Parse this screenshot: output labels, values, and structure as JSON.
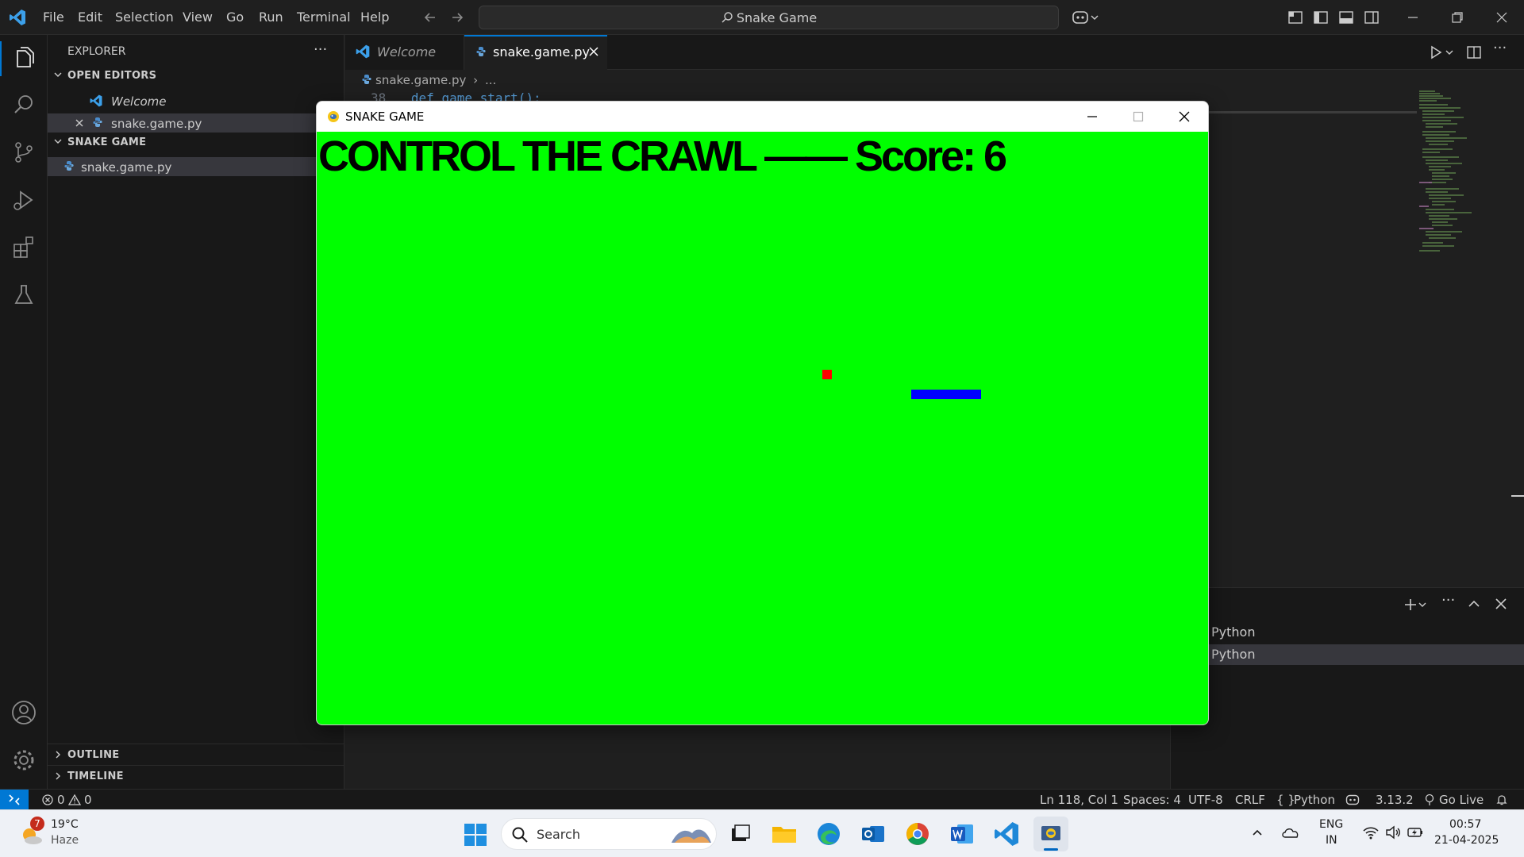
{
  "menu": [
    "File",
    "Edit",
    "Selection",
    "View",
    "Go",
    "Run",
    "Terminal",
    "Help"
  ],
  "command_center": {
    "label": "Snake Game"
  },
  "explorer": {
    "title": "EXPLORER",
    "open_editors_header": "OPEN EDITORS",
    "open_editors": [
      "Welcome",
      "snake.game.py"
    ],
    "folder_header": "SNAKE GAME",
    "folder_files": [
      "snake.game.py"
    ],
    "outline_header": "OUTLINE",
    "timeline_header": "TIMELINE"
  },
  "tabs": [
    {
      "label": "Welcome"
    },
    {
      "label": "snake.game.py"
    }
  ],
  "breadcrumb": {
    "file": "snake.game.py",
    "more": "..."
  },
  "code_peek": {
    "line_number": "38",
    "text": "def game_start():"
  },
  "terminal": {
    "entries": [
      "Python",
      "Python"
    ]
  },
  "game": {
    "window_title": "SNAKE GAME",
    "score_text": "CONTROL THE CRAWL —— Score: 6",
    "colors": {
      "background": "#00ff00",
      "food": "#ff0000",
      "snake": "#0000ff",
      "text": "#000000"
    }
  },
  "status": {
    "errors": "0",
    "warnings": "0",
    "position": "Ln 118, Col 1",
    "spaces": "Spaces: 4",
    "encoding": "UTF-8",
    "eol": "CRLF",
    "language": "Python",
    "python_version": "3.13.2",
    "go_live": "Go Live"
  },
  "taskbar": {
    "weather_badge": "7",
    "temperature": "19°C",
    "condition": "Haze",
    "search_placeholder": "Search",
    "lang_top": "ENG",
    "lang_bottom": "IN",
    "time": "00:57",
    "date": "21-04-2025"
  }
}
